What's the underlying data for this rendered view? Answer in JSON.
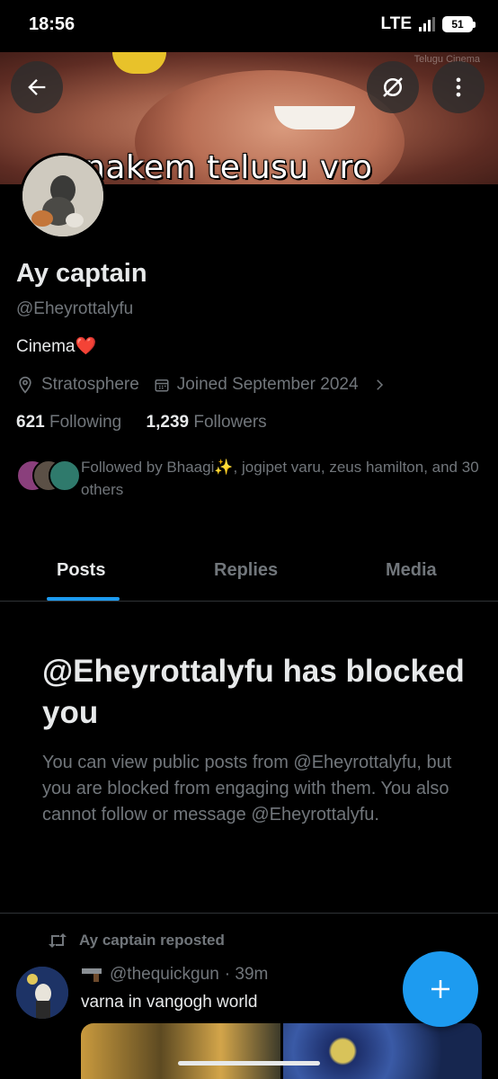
{
  "status_bar": {
    "time": "18:56",
    "network": "LTE",
    "battery": "51"
  },
  "banner": {
    "caption": "nakem telusu vro",
    "corner_text": "Telugu Cinema"
  },
  "profile": {
    "name": "Ay captain",
    "handle": "@Eheyrottalyfu",
    "bio": "Cinema❤️",
    "location": "Stratosphere",
    "joined": "Joined September 2024",
    "following_count": "621",
    "following_label": "Following",
    "followers_count": "1,239",
    "followers_label": "Followers",
    "followed_by": "Followed by Bhaagi✨, jogipet varu, zeus hamilton, and 30 others"
  },
  "tabs": [
    {
      "label": "Posts"
    },
    {
      "label": "Replies"
    },
    {
      "label": "Media"
    }
  ],
  "blocked_notice": {
    "title": "@Eheyrottalyfu has blocked you",
    "body": "You can view public posts from @Eheyrottalyfu, but you are blocked from engaging with them. You also cannot follow or message @Eheyrottalyfu."
  },
  "post": {
    "repost_label": "Ay captain reposted",
    "author_handle": "@thequickgun",
    "time": "· 39m",
    "text": "varna in vangogh world"
  },
  "colors": {
    "accent": "#1d9bf0",
    "background": "#000000",
    "secondary_text": "#71767b"
  }
}
